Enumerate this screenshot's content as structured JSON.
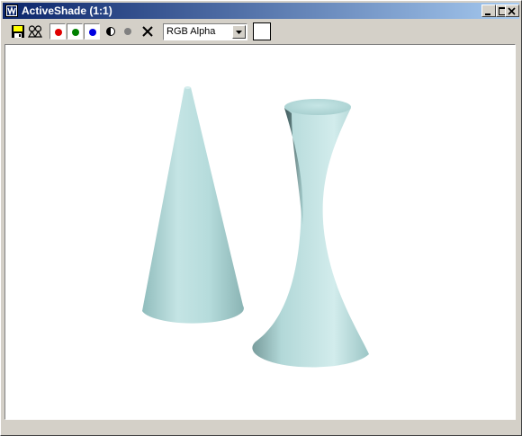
{
  "window": {
    "title": "ActiveShade (1:1)"
  },
  "titlebar_buttons": [
    {
      "name": "minimize-button",
      "icon": "minimize-icon"
    },
    {
      "name": "maximize-button",
      "icon": "maximize-icon"
    },
    {
      "name": "close-button",
      "icon": "close-icon"
    }
  ],
  "toolbar": {
    "tools": [
      {
        "name": "save-image-button",
        "icon": "floppy-disk-icon"
      },
      {
        "name": "clone-window-button",
        "icon": "clone-icon"
      },
      {
        "name": "red-channel-toggle",
        "icon": "red-dot-icon",
        "color": "#e00000",
        "active": true
      },
      {
        "name": "green-channel-toggle",
        "icon": "green-dot-icon",
        "color": "#008000",
        "active": true
      },
      {
        "name": "blue-channel-toggle",
        "icon": "blue-dot-icon",
        "color": "#0000e0",
        "active": true
      },
      {
        "name": "monochrome-toggle",
        "icon": "half-circle-icon"
      },
      {
        "name": "alpha-toggle",
        "icon": "gray-dot-icon",
        "color": "#808080"
      },
      {
        "name": "clear-button",
        "icon": "x-icon"
      }
    ],
    "channel_select": {
      "value": "RGB Alpha"
    },
    "background_swatch": {
      "color": "#ffffff"
    }
  },
  "viewport": {
    "background": "#ffffff",
    "objects": [
      {
        "name": "cone",
        "color": "#b6dcdc"
      },
      {
        "name": "hourglass-vase",
        "color": "#b6dcdc"
      }
    ]
  }
}
